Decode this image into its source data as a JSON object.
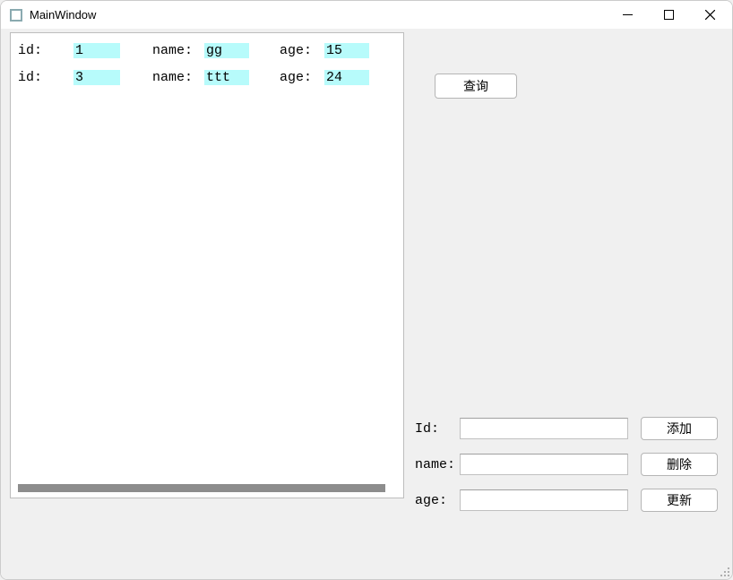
{
  "window": {
    "title": "MainWindow"
  },
  "list": {
    "rows": [
      {
        "id_label": "id:",
        "id_val": "1",
        "name_label": "name:",
        "name_val": "gg",
        "age_label": "age:",
        "age_val": "15"
      },
      {
        "id_label": "id:",
        "id_val": "3",
        "name_label": "name:",
        "name_val": "ttt",
        "age_label": "age:",
        "age_val": "24"
      }
    ]
  },
  "buttons": {
    "query": "查询",
    "add": "添加",
    "delete": "删除",
    "update": "更新"
  },
  "form": {
    "id_label": "Id:",
    "name_label": "name:",
    "age_label": "age:",
    "id_value": "",
    "name_value": "",
    "age_value": ""
  }
}
